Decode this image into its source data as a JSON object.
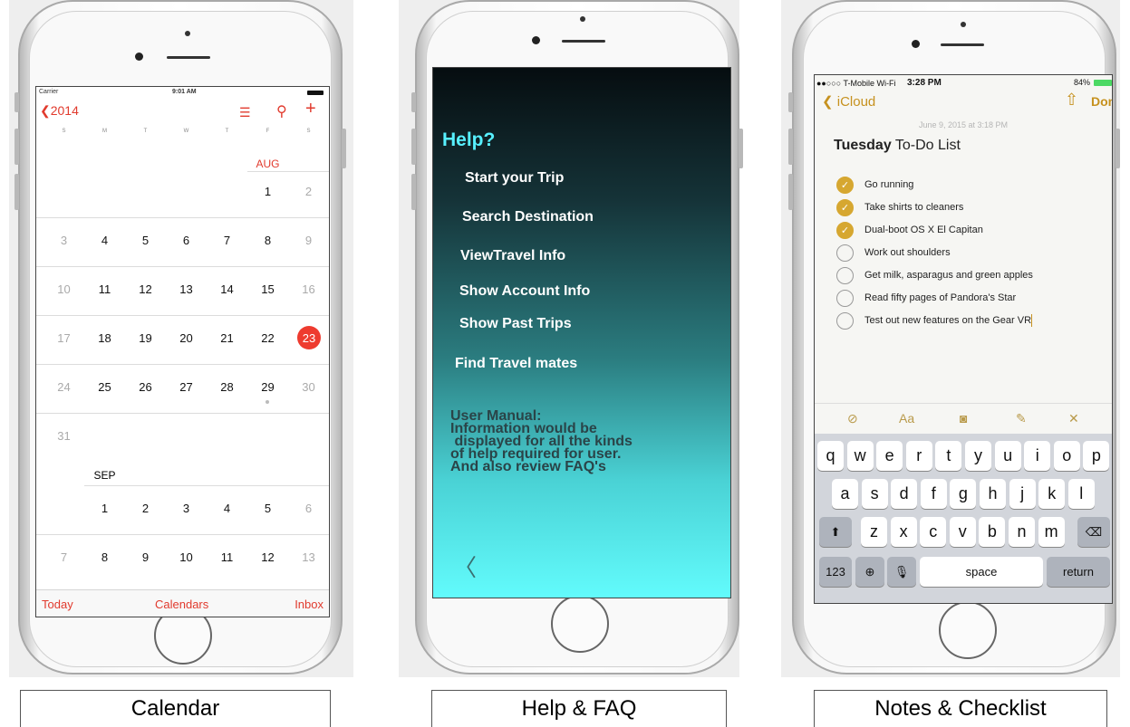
{
  "captions": {
    "calendar": "Calendar",
    "help": "Help & FAQ",
    "notes": "Notes & Checklist"
  },
  "calendar": {
    "status": {
      "carrier": "Carrier",
      "time": "9:01 AM"
    },
    "year_back": "2014",
    "icons": [
      "list-icon",
      "search-icon",
      "add-icon"
    ],
    "weekdays": [
      "S",
      "M",
      "T",
      "W",
      "T",
      "F",
      "S"
    ],
    "month_aug": "AUG",
    "month_sep": "SEP",
    "aug_weeks": [
      [
        "",
        "",
        "",
        "",
        "",
        "1",
        "2"
      ],
      [
        "3",
        "4",
        "5",
        "6",
        "7",
        "8",
        "9"
      ],
      [
        "10",
        "11",
        "12",
        "13",
        "14",
        "15",
        "16"
      ],
      [
        "17",
        "18",
        "19",
        "20",
        "21",
        "22",
        "23"
      ],
      [
        "24",
        "25",
        "26",
        "27",
        "28",
        "29",
        "30"
      ],
      [
        "31",
        "",
        "",
        "",
        "",
        "",
        ""
      ]
    ],
    "sep_weeks": [
      [
        "",
        "1",
        "2",
        "3",
        "4",
        "5",
        "6"
      ],
      [
        "7",
        "8",
        "9",
        "10",
        "11",
        "12",
        "13"
      ]
    ],
    "today": "23",
    "tabbar": {
      "left": "Today",
      "center": "Calendars",
      "right": "Inbox"
    },
    "accent": "#e13a2d"
  },
  "help": {
    "title": "Help?",
    "items": [
      "Start  your Trip",
      "Search  Destination",
      "ViewTravel Info",
      "Show Account Info",
      "Show Past Trips",
      "Find Travel mates"
    ],
    "manual_lines": [
      "User Manual:",
      "Information would be",
      " displayed for all the kinds",
      "of help required for user.",
      "And also review FAQ's"
    ],
    "back_icon": "chevron-left-icon",
    "accent": "#57f0ff"
  },
  "notes": {
    "status": {
      "carrier": "●●○○○ T-Mobile Wi-Fi",
      "time": "3:28 PM",
      "battery": "84%"
    },
    "back_label": "iCloud",
    "done_label": "Done",
    "date": "June 9, 2015 at 3:18 PM",
    "title_bold": "Tuesday",
    "title_rest": " To-Do List",
    "checklist": [
      {
        "text": "Go running",
        "checked": true
      },
      {
        "text": "Take shirts to cleaners",
        "checked": true
      },
      {
        "text": "Dual-boot OS X El Capitan",
        "checked": true
      },
      {
        "text": "Work out shoulders",
        "checked": false
      },
      {
        "text": "Get milk, asparagus and green apples",
        "checked": false
      },
      {
        "text": "Read fifty pages of Pandora's Star",
        "checked": false
      },
      {
        "text": "Test out new features on the Gear VR",
        "checked": false
      }
    ],
    "format_icons": [
      "checklist-icon",
      "text-style-icon",
      "camera-icon",
      "sketch-icon",
      "close-icon"
    ],
    "format_labels": {
      "text_style": "Aa"
    },
    "keyboard": {
      "row1": [
        "q",
        "w",
        "e",
        "r",
        "t",
        "y",
        "u",
        "i",
        "o",
        "p"
      ],
      "row2": [
        "a",
        "s",
        "d",
        "f",
        "g",
        "h",
        "j",
        "k",
        "l"
      ],
      "row3": [
        "z",
        "x",
        "c",
        "v",
        "b",
        "n",
        "m"
      ],
      "numbers": "123",
      "space": "space",
      "return": "return"
    },
    "accent": "#c6911e"
  }
}
